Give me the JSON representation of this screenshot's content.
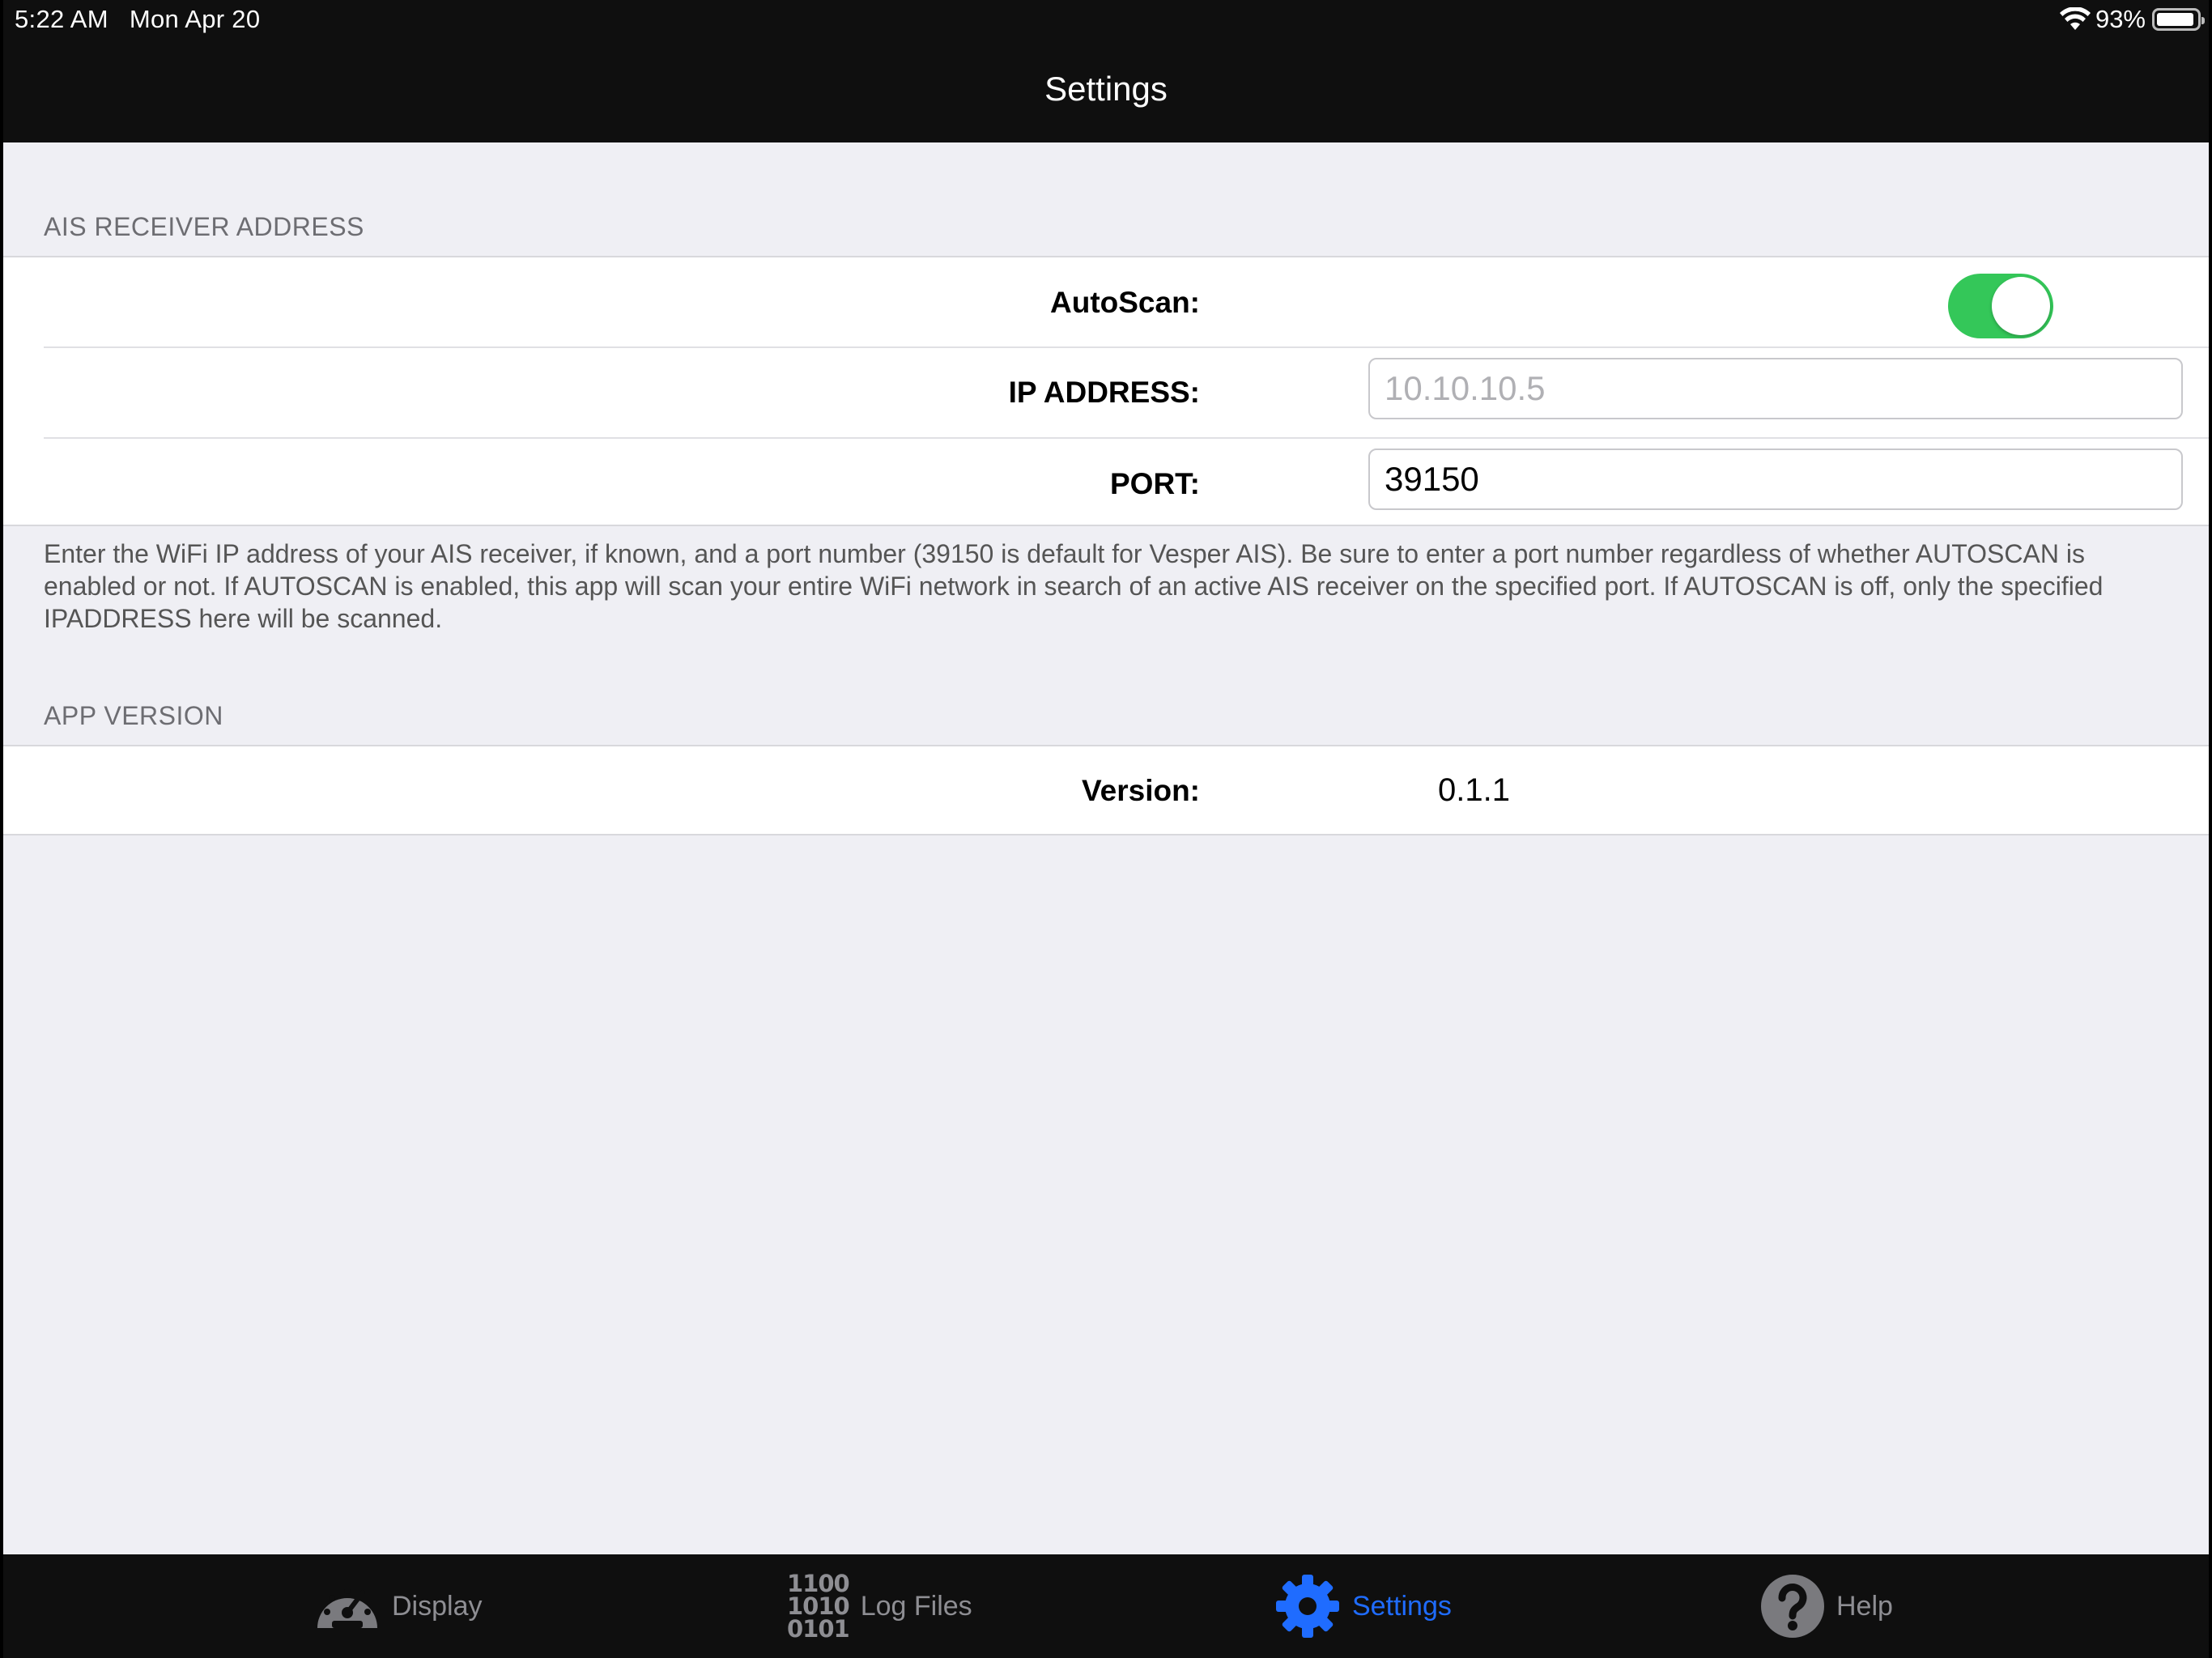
{
  "status_bar": {
    "time": "5:22 AM",
    "date": "Mon Apr 20",
    "battery_percent": "93%",
    "battery_level": 0.93
  },
  "nav": {
    "title": "Settings"
  },
  "ais_section": {
    "header": "AIS RECEIVER ADDRESS",
    "autoscan_label": "AutoScan:",
    "autoscan_on": true,
    "ip_label": "IP ADDRESS:",
    "ip_placeholder": "10.10.10.5",
    "ip_value": "",
    "port_label": "PORT:",
    "port_value": "39150",
    "footer": "Enter the WiFi IP address of your AIS receiver, if known, and a port number (39150 is default for Vesper AIS).  Be sure to enter a port number regardless of whether AUTOSCAN is enabled or not.  If AUTOSCAN is enabled, this app will scan your entire WiFi network in search of an active AIS receiver on the specified port.  If AUTOSCAN is off, only the specified IPADDRESS here will be scanned."
  },
  "version_section": {
    "header": "APP VERSION",
    "version_label": "Version:",
    "version_value": "0.1.1"
  },
  "tab_bar": {
    "tabs": [
      {
        "label": "Display",
        "icon": "speedometer-icon",
        "active": false
      },
      {
        "label": "Log Files",
        "icon": "binary-icon",
        "active": false,
        "icon_text": [
          "1100",
          "1010",
          "0101"
        ]
      },
      {
        "label": "Settings",
        "icon": "gear-icon",
        "active": true
      },
      {
        "label": "Help",
        "icon": "help-icon",
        "active": false
      }
    ]
  },
  "colors": {
    "accent": "#1f6cff",
    "toggle_on": "#34c759",
    "bar_background": "#0f0f0f",
    "page_background": "#efeff4"
  }
}
